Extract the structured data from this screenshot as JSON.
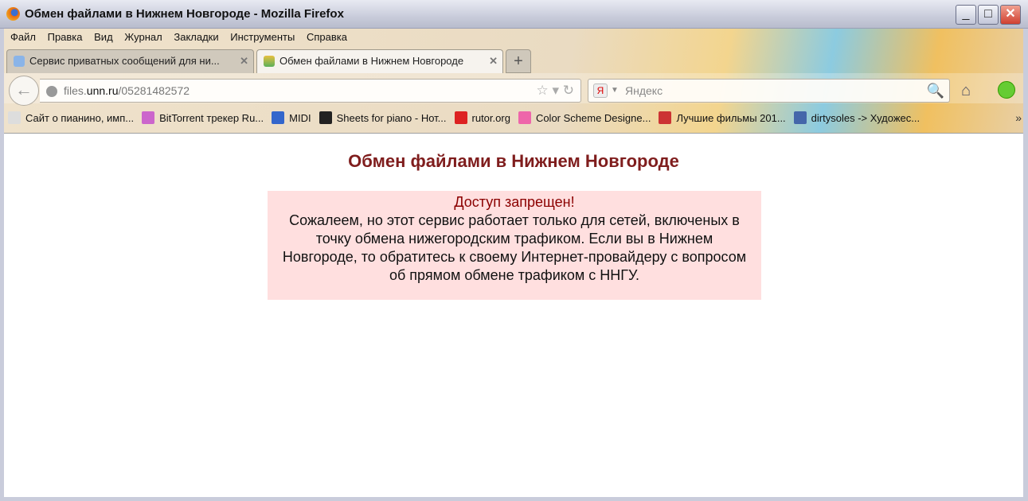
{
  "window": {
    "title": "Обмен файлами в Нижнем Новгороде - Mozilla Firefox",
    "minimize": "_",
    "maximize": "□",
    "close": "✕"
  },
  "menu": [
    "Файл",
    "Правка",
    "Вид",
    "Журнал",
    "Закладки",
    "Инструменты",
    "Справка"
  ],
  "tabs": [
    {
      "label": "Сервис приватных сообщений для ни...",
      "active": false
    },
    {
      "label": "Обмен файлами в Нижнем Новгороде",
      "active": true
    }
  ],
  "tab_close": "✕",
  "new_tab": "+",
  "nav": {
    "back": "←",
    "url_prefix": "files.",
    "url_host": "unn.ru",
    "url_path": "/05281482572",
    "url_icons": "☆ ▾ ↻"
  },
  "search": {
    "engine": "Я",
    "placeholder": "Яндекс",
    "icon": "🔍"
  },
  "home_icon": "⌂",
  "bookmarks": [
    {
      "label": "Сайт о пианино, имп...",
      "color": "#ddd"
    },
    {
      "label": "BitTorrent трекер Ru...",
      "color": "#c6c"
    },
    {
      "label": "MIDI",
      "color": "#36c"
    },
    {
      "label": "Sheets for piano - Нот...",
      "color": "#222"
    },
    {
      "label": "rutor.org",
      "color": "#d22"
    },
    {
      "label": "Color Scheme Designe...",
      "color": "#e6a"
    },
    {
      "label": "Лучшие фильмы 201...",
      "color": "#c33"
    },
    {
      "label": "dirtysoles -> Художес...",
      "color": "#46a"
    }
  ],
  "bookmarks_more": "»",
  "page": {
    "heading": "Обмен файлами в Нижнем Новгороде",
    "error_title": "Доступ запрещен!",
    "message_lines": [
      "Сожалеем, но этот сервис работает только для сетей, включеных в",
      "точку обмена нижегородским трафиком. Если вы в Нижнем",
      "Новгороде, то обратитесь к своему Интернет-провайдеру с вопросом",
      "об прямом обмене трафиком с ННГУ."
    ]
  }
}
